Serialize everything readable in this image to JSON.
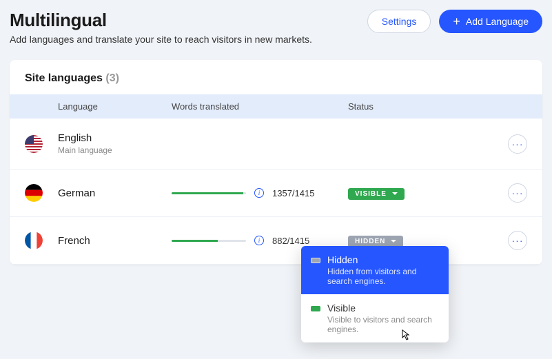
{
  "header": {
    "title": "Multilingual",
    "subtitle": "Add languages and translate your site to reach visitors in new markets.",
    "settings_label": "Settings",
    "add_language_label": "Add Language"
  },
  "card": {
    "title": "Site languages",
    "count_display": "(3)"
  },
  "columns": {
    "language": "Language",
    "words_translated": "Words translated",
    "status": "Status"
  },
  "languages": [
    {
      "name": "English",
      "sub": "Main language",
      "progress_pct": null,
      "words": null,
      "status": null
    },
    {
      "name": "German",
      "sub": null,
      "progress_pct": 96,
      "words": "1357/1415",
      "status": {
        "label": "VISIBLE",
        "kind": "visible"
      }
    },
    {
      "name": "French",
      "sub": null,
      "progress_pct": 62,
      "words": "882/1415",
      "status": {
        "label": "HIDDEN",
        "kind": "hidden"
      }
    }
  ],
  "dropdown": {
    "hidden": {
      "title": "Hidden",
      "desc": "Hidden from visitors and search engines."
    },
    "visible": {
      "title": "Visible",
      "desc": "Visible to visitors and search engines."
    }
  }
}
